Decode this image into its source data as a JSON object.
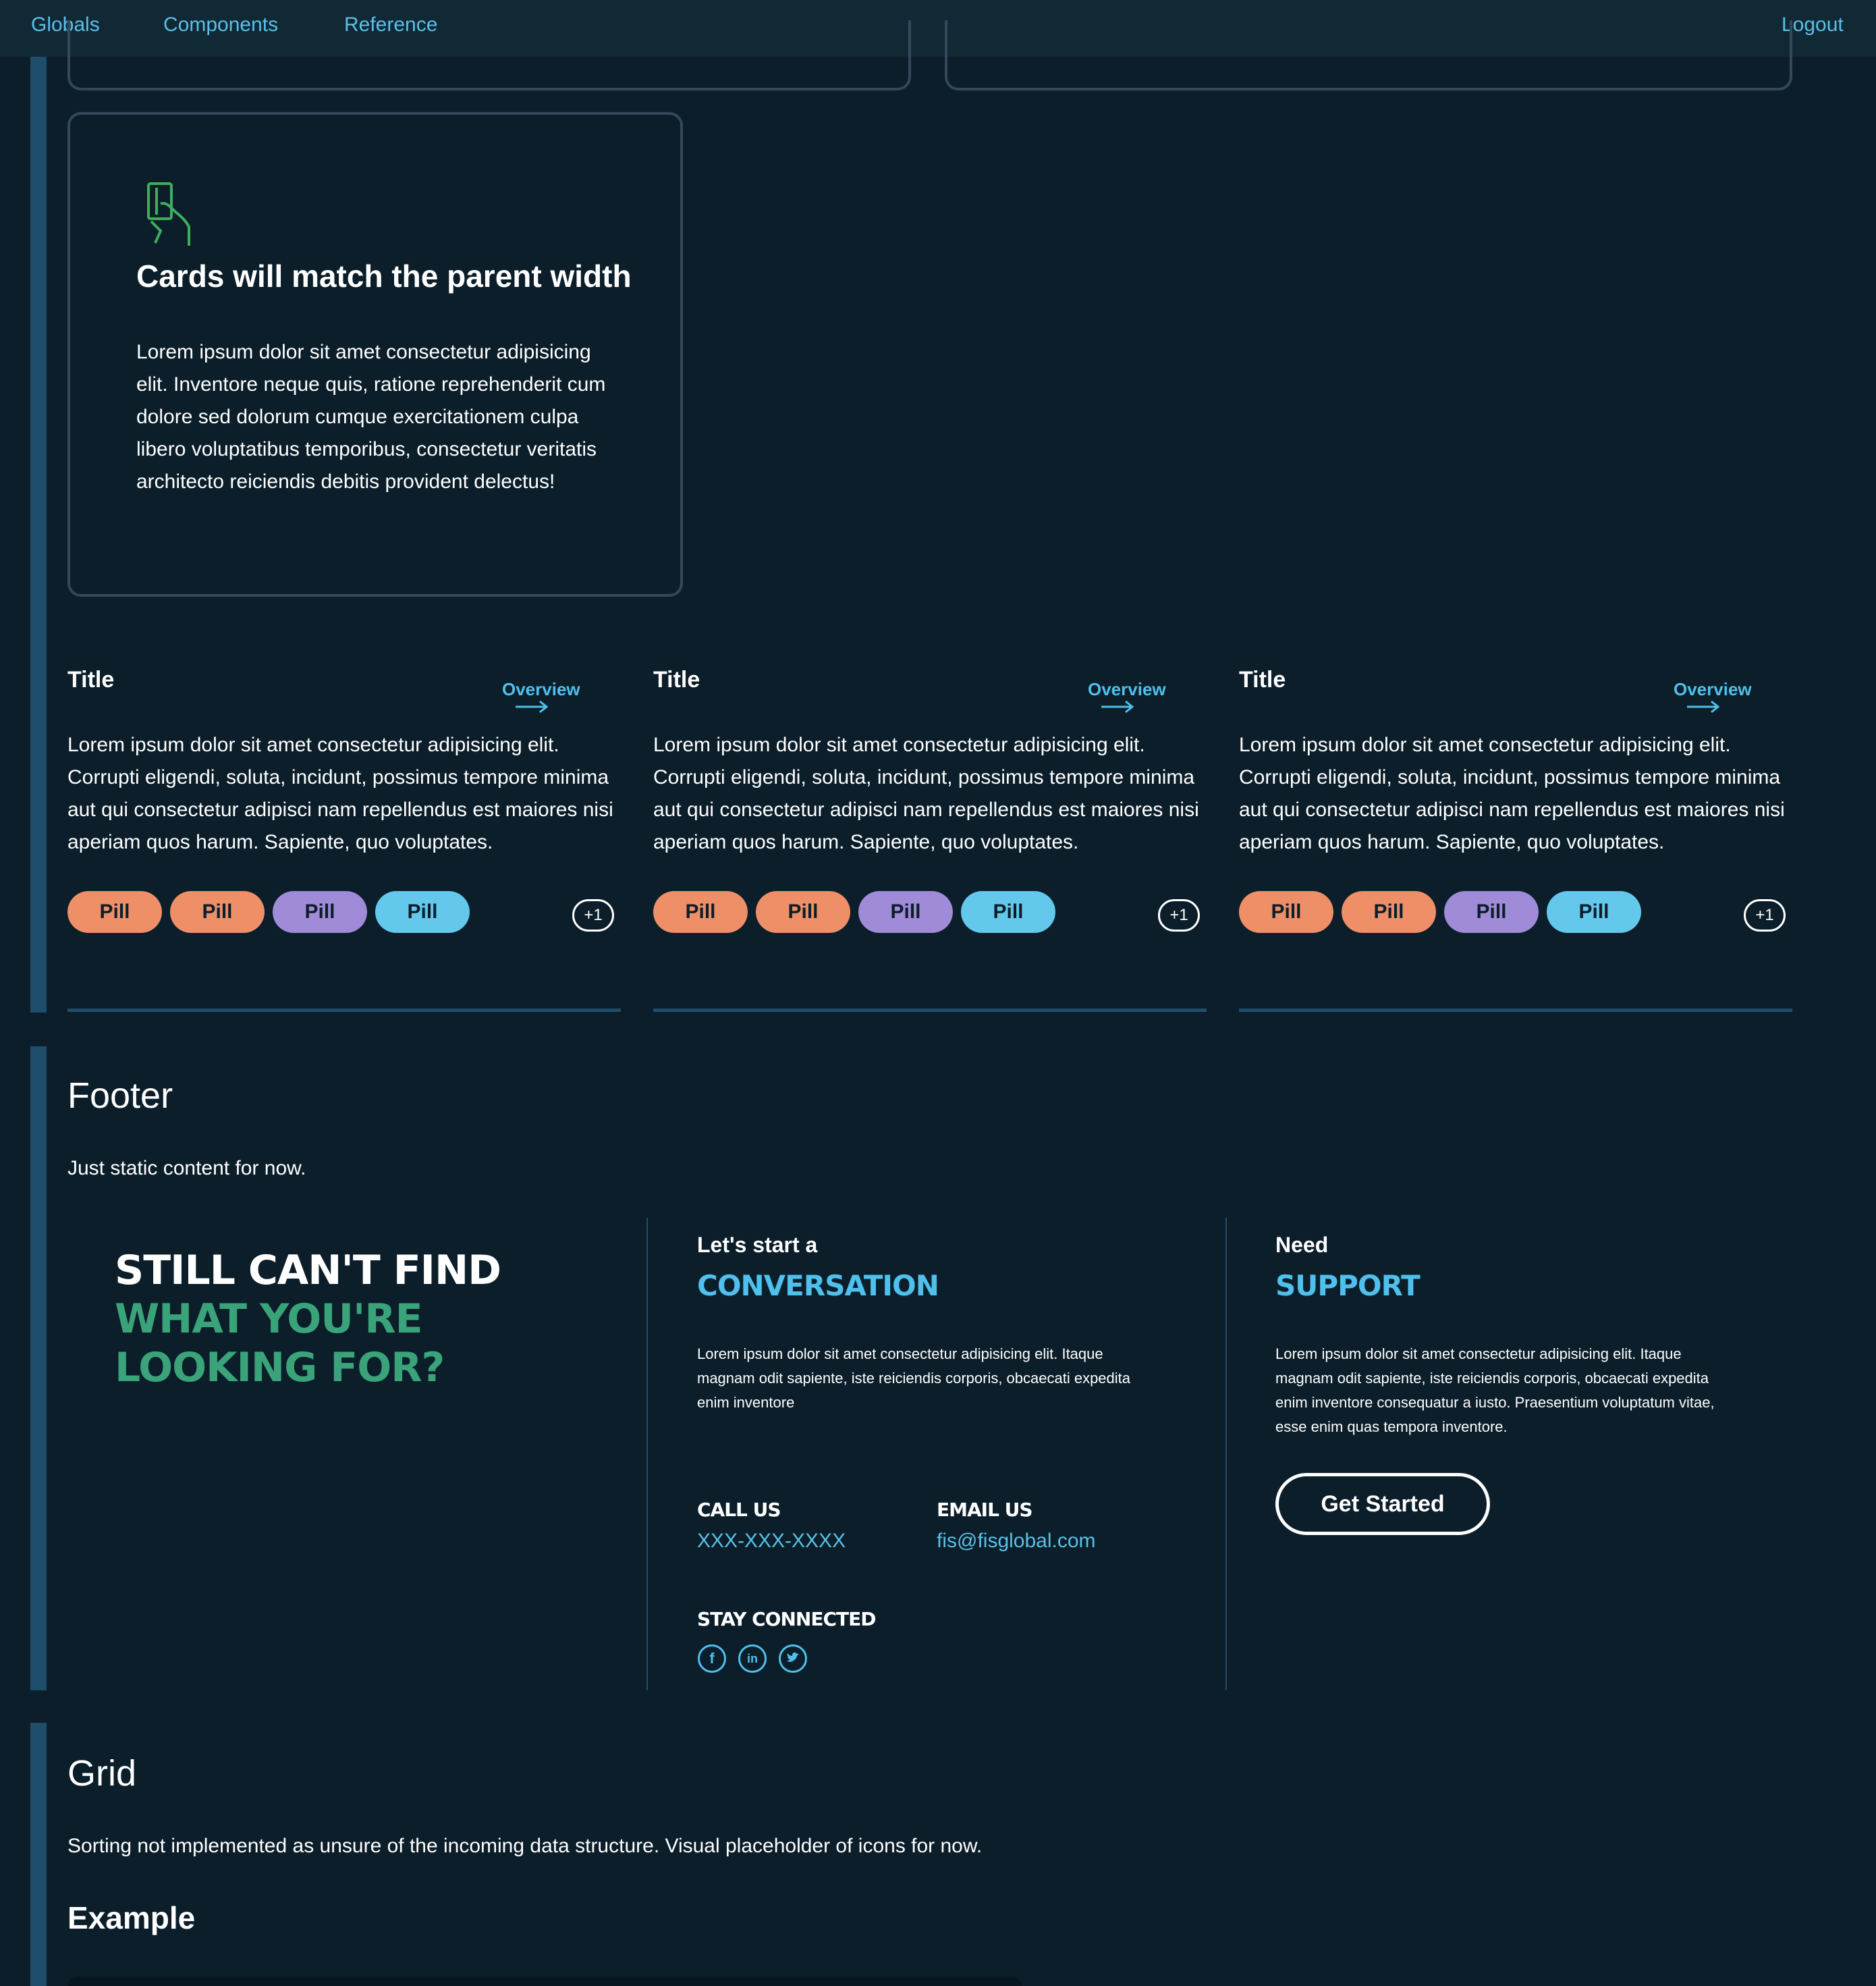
{
  "nav": {
    "items": [
      "Globals",
      "Components",
      "Reference"
    ],
    "logout": "Logout"
  },
  "card": {
    "icon": "card-hand-icon",
    "title": "Cards will match the parent width",
    "body": "Lorem ipsum dolor sit amet consectetur adipisicing elit. Inventore neque quis, ratione reprehenderit cum dolore sed dolorum cumque exercitationem culpa libero voluptatibus temporibus, consectetur veritatis architecto reiciendis debitis provident delectus!"
  },
  "columns": [
    {
      "title": "Title",
      "overview": "Overview",
      "body": "Lorem ipsum dolor sit amet consectetur adipisicing elit. Corrupti eligendi, soluta, incidunt, possimus tempore minima aut qui consectetur adipisci nam repellendus est maiores nisi aperiam quos harum. Sapiente, quo voluptates.",
      "pills": [
        "Pill",
        "Pill",
        "Pill",
        "Pill"
      ],
      "more": "+1"
    },
    {
      "title": "Title",
      "overview": "Overview",
      "body": "Lorem ipsum dolor sit amet consectetur adipisicing elit. Corrupti eligendi, soluta, incidunt, possimus tempore minima aut qui consectetur adipisci nam repellendus est maiores nisi aperiam quos harum. Sapiente, quo voluptates.",
      "pills": [
        "Pill",
        "Pill",
        "Pill",
        "Pill"
      ],
      "more": "+1"
    },
    {
      "title": "Title",
      "overview": "Overview",
      "body": "Lorem ipsum dolor sit amet consectetur adipisicing elit. Corrupti eligendi, soluta, incidunt, possimus tempore minima aut qui consectetur adipisci nam repellendus est maiores nisi aperiam quos harum. Sapiente, quo voluptates.",
      "pills": [
        "Pill",
        "Pill",
        "Pill",
        "Pill"
      ],
      "more": "+1"
    }
  ],
  "footer_section": {
    "heading": "Footer",
    "description": "Just static content for now.",
    "headline": [
      "STILL CAN'T FIND",
      "WHAT YOU'RE",
      "LOOKING FOR?"
    ],
    "conversation": {
      "lead": "Let's start a",
      "accent": "CONVERSATION",
      "body": "Lorem ipsum dolor sit amet consectetur adipisicing elit. Itaque magnam odit sapiente, iste reiciendis corporis, obcaecati expedita enim inventore",
      "call_label": "CALL US",
      "call_value": "XXX-XXX-XXXX",
      "email_label": "EMAIL US",
      "email_value": "fis@fisglobal.com",
      "social_label": "STAY CONNECTED",
      "social_icons": [
        "facebook-icon",
        "linkedin-icon",
        "twitter-icon"
      ]
    },
    "support": {
      "lead": "Need",
      "accent": "SUPPORT",
      "body": "Lorem ipsum dolor sit amet consectetur adipisicing elit. Itaque magnam odit sapiente, iste reiciendis corporis, obcaecati expedita enim inventore consequatur a iusto. Praesentium voluptatum vitae, esse enim quas tempora inventore.",
      "button": "Get Started"
    }
  },
  "grid_section": {
    "heading": "Grid",
    "description": "Sorting not implemented as unsure of the incoming data structure. Visual placeholder of icons for now.",
    "example": "Example"
  },
  "colors": {
    "background": "#0b1e2a",
    "accent": "#4fc0ec",
    "green": "#3aa37a",
    "pill_orange": "#ef8f68",
    "pill_purple": "#9f8bd8",
    "pill_blue": "#63c8ec"
  }
}
